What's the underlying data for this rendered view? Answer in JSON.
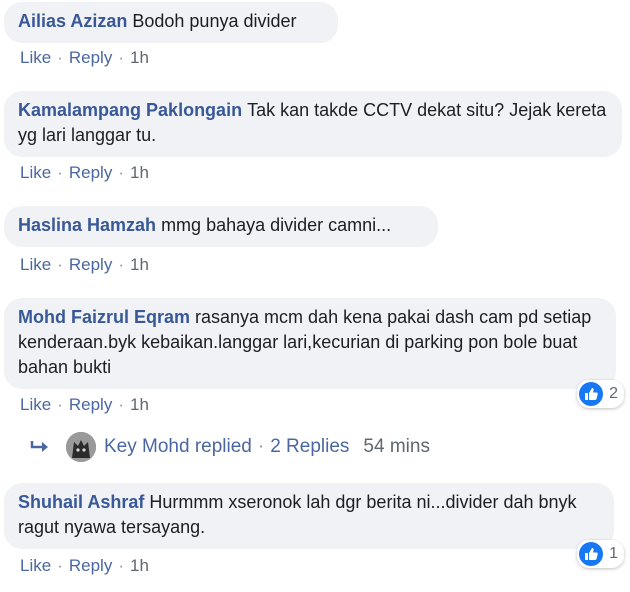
{
  "comments": [
    {
      "author": "Ailias Azizan",
      "text": "Bodoh punya divider",
      "like": "Like",
      "reply": "Reply",
      "time": "1h"
    },
    {
      "author": "Kamalampang Paklongain",
      "text": "Tak kan takde CCTV dekat situ? Jejak kereta yg lari langgar tu.",
      "like": "Like",
      "reply": "Reply",
      "time": "1h"
    },
    {
      "author": "Haslina Hamzah",
      "text": "mmg bahaya divider camni...",
      "like": "Like",
      "reply": "Reply",
      "time": "1h"
    },
    {
      "author": "Mohd Faizrul Eqram",
      "text": "rasanya mcm dah kena pakai dash cam pd setiap kenderaan.byk kebaikan.langgar lari,kecurian di parking pon bole buat bahan bukti",
      "like": "Like",
      "reply": "Reply",
      "time": "1h",
      "reaction_count": "2"
    },
    {
      "author": "Shuhail Ashraf",
      "text": "Hurmmm xseronok lah dgr berita ni...divider dah bnyk ragut nyawa tersayang.",
      "like": "Like",
      "reply": "Reply",
      "time": "1h",
      "reaction_count": "1"
    }
  ],
  "replies_summary": {
    "name_text": "Key Mohd replied",
    "separator": "·",
    "count_text": "2 Replies",
    "time": "54 mins"
  },
  "colors": {
    "author": "#385898",
    "bubble_bg": "#f0f2f5",
    "like_blue": "#1877f2"
  }
}
